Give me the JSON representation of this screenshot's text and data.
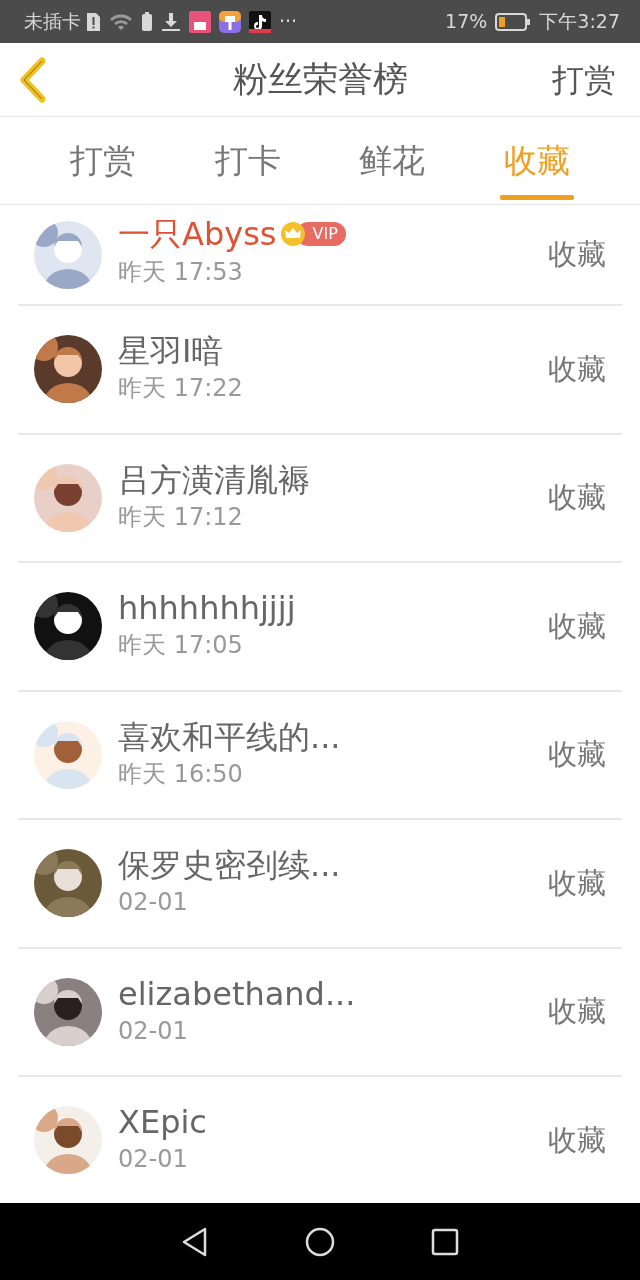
{
  "status_bar": {
    "carrier": "未插卡",
    "more": "···",
    "battery_percent": "17%",
    "time": "下午3:27"
  },
  "header": {
    "title": "粉丝荣誉榜",
    "action": "打赏"
  },
  "tabs": [
    {
      "label": "打赏",
      "selected": false
    },
    {
      "label": "打卡",
      "selected": false
    },
    {
      "label": "鲜花",
      "selected": false
    },
    {
      "label": "收藏",
      "selected": true
    }
  ],
  "fans": [
    {
      "name": "一只Abyss",
      "vip": true,
      "vip_label": "VIP",
      "time": "昨天 17:53",
      "action": "收藏"
    },
    {
      "name": "星羽I暗",
      "vip": false,
      "time": "昨天 17:22",
      "action": "收藏"
    },
    {
      "name": "吕方潢清胤褥",
      "vip": false,
      "time": "昨天 17:12",
      "action": "收藏"
    },
    {
      "name": "hhhhhhhjjjj",
      "vip": false,
      "time": "昨天 17:05",
      "action": "收藏"
    },
    {
      "name": "喜欢和平线的...",
      "vip": false,
      "time": "昨天 16:50",
      "action": "收藏"
    },
    {
      "name": "保罗史密刭续...",
      "vip": false,
      "time": "02-01",
      "action": "收藏"
    },
    {
      "name": "elizabethand...",
      "vip": false,
      "time": "02-01",
      "action": "收藏"
    },
    {
      "name": "XEpic",
      "vip": false,
      "time": "02-01",
      "action": "收藏"
    }
  ]
}
